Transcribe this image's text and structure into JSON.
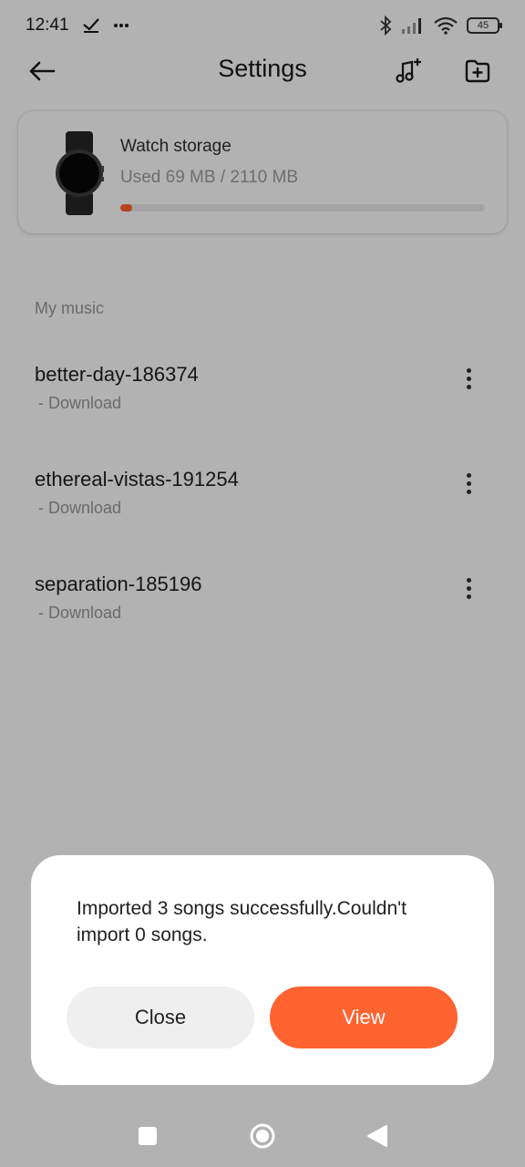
{
  "status_bar": {
    "time": "12:41",
    "battery": "45",
    "icons": [
      "check-icon",
      "more-icon",
      "bluetooth-icon",
      "signal-icon",
      "wifi-icon",
      "battery-icon"
    ]
  },
  "header": {
    "title": "Settings",
    "icons": [
      "back-arrow-icon",
      "add-music-icon",
      "add-folder-icon"
    ]
  },
  "storage": {
    "title": "Watch storage",
    "usage_text": "Used 69 MB / 2110 MB",
    "used_fraction": 0.033,
    "accent_color": "#b8431f"
  },
  "music": {
    "section_label": "My music",
    "songs": [
      {
        "title": "better-day-186374",
        "subtitle": " - Download"
      },
      {
        "title": "ethereal-vistas-191254",
        "subtitle": " - Download"
      },
      {
        "title": "separation-185196",
        "subtitle": " - Download"
      }
    ]
  },
  "dialog": {
    "message": "Imported 3 songs successfully.Couldn't import 0 songs.",
    "close_label": "Close",
    "view_label": "View",
    "primary_color": "#ff6330"
  },
  "nav": {
    "icons": [
      "recents-square-icon",
      "home-circle-icon",
      "back-triangle-icon"
    ]
  }
}
